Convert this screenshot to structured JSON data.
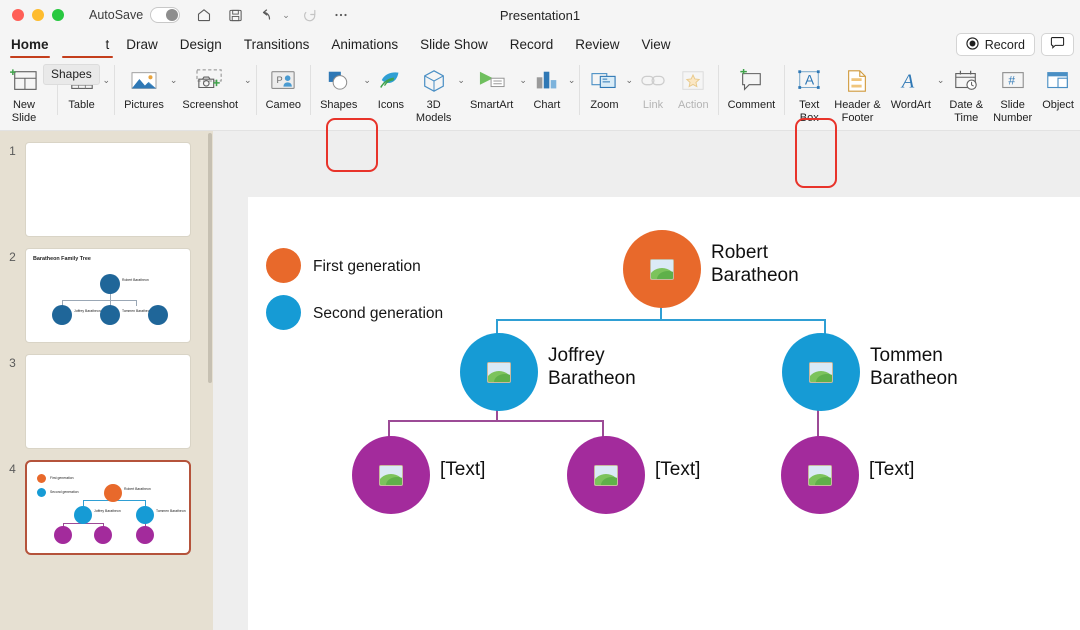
{
  "window": {
    "title": "Presentation1",
    "autosave_label": "AutoSave",
    "traffic_lights": [
      "close",
      "minimize",
      "maximize"
    ],
    "toolbar_icons": [
      "home-icon",
      "save-icon",
      "undo-icon",
      "redo-icon",
      "more-icon"
    ]
  },
  "tabs": [
    {
      "label": "Home",
      "state": "active"
    },
    {
      "label": "t",
      "state": "partial",
      "full": "Insert"
    },
    {
      "label": "Draw",
      "state": "normal"
    },
    {
      "label": "Design",
      "state": "normal"
    },
    {
      "label": "Transitions",
      "state": "normal"
    },
    {
      "label": "Animations",
      "state": "normal"
    },
    {
      "label": "Slide Show",
      "state": "normal"
    },
    {
      "label": "Record",
      "state": "normal"
    },
    {
      "label": "Review",
      "state": "normal"
    },
    {
      "label": "View",
      "state": "normal"
    }
  ],
  "tooltip": {
    "text": "Shapes"
  },
  "tabbar_right": {
    "record_label": "Record",
    "record_icon": "record-circle-icon",
    "comment_icon": "comment-bubble-icon"
  },
  "ribbon": {
    "items": [
      {
        "label": "New\nSlide",
        "icon": "new-slide-icon",
        "caret": true,
        "disabled": false
      },
      {
        "label": "Table",
        "icon": "table-icon",
        "caret": true,
        "disabled": false
      },
      {
        "label": "Pictures",
        "icon": "pictures-icon",
        "caret": true,
        "disabled": false
      },
      {
        "label": "Screenshot",
        "icon": "screenshot-icon",
        "caret": true,
        "disabled": false
      },
      {
        "label": "Cameo",
        "icon": "cameo-icon",
        "caret": false,
        "disabled": false
      },
      {
        "label": "Shapes",
        "icon": "shapes-icon",
        "caret": true,
        "disabled": false,
        "highlighted": true
      },
      {
        "label": "Icons",
        "icon": "icons-icon",
        "caret": false,
        "disabled": false
      },
      {
        "label": "3D\nModels",
        "icon": "3d-models-icon",
        "caret": true,
        "disabled": false
      },
      {
        "label": "SmartArt",
        "icon": "smartart-icon",
        "caret": true,
        "disabled": false
      },
      {
        "label": "Chart",
        "icon": "chart-icon",
        "caret": true,
        "disabled": false
      },
      {
        "label": "Zoom",
        "icon": "zoom-icon",
        "caret": true,
        "disabled": false
      },
      {
        "label": "Link",
        "icon": "link-icon",
        "caret": false,
        "disabled": true
      },
      {
        "label": "Action",
        "icon": "action-star-icon",
        "caret": false,
        "disabled": true
      },
      {
        "label": "Comment",
        "icon": "comment-icon",
        "caret": false,
        "disabled": false
      },
      {
        "label": "Text\nBox",
        "icon": "text-box-icon",
        "caret": false,
        "disabled": false,
        "highlighted": true
      },
      {
        "label": "Header &\nFooter",
        "icon": "header-footer-icon",
        "caret": false,
        "disabled": false
      },
      {
        "label": "WordArt",
        "icon": "wordart-icon",
        "caret": true,
        "disabled": false
      },
      {
        "label": "Date &\nTime",
        "icon": "date-time-icon",
        "caret": false,
        "disabled": false
      },
      {
        "label": "Slide\nNumber",
        "icon": "slide-number-icon",
        "caret": false,
        "disabled": false
      },
      {
        "label": "Object",
        "icon": "object-icon",
        "caret": false,
        "disabled": false
      }
    ]
  },
  "slide_panel": {
    "thumbnails": [
      {
        "number": "1",
        "selected": false,
        "type": "blank"
      },
      {
        "number": "2",
        "selected": false,
        "type": "family-tree-dark",
        "title": "Baratheon Family Tree"
      },
      {
        "number": "3",
        "selected": false,
        "type": "blank"
      },
      {
        "number": "4",
        "selected": true,
        "type": "family-tree-color"
      }
    ],
    "thumb2_labels": [
      "Robert\nBaratheon",
      "Joffrey\nBaratheon",
      "Tommen\nBaratheon"
    ],
    "thumb4_labels": [
      "First generation",
      "Second generation",
      "Robert\nBaratheon",
      "Joffrey\nBaratheon",
      "Tommen\nBaratheon"
    ]
  },
  "slide": {
    "legend": [
      {
        "label": "First generation",
        "color": "#E8692B"
      },
      {
        "label": "Second generation",
        "color": "#169BD5"
      }
    ],
    "nodes": [
      {
        "id": "robert",
        "label": "Robert\nBaratheon",
        "color": "#E8692B",
        "generation": 1,
        "icon": "picture-placeholder-icon"
      },
      {
        "id": "joffrey",
        "label": "Joffrey\nBaratheon",
        "color": "#169BD5",
        "generation": 2,
        "icon": "picture-placeholder-icon"
      },
      {
        "id": "tommen",
        "label": "Tommen\nBaratheon",
        "color": "#169BD5",
        "generation": 2,
        "icon": "picture-placeholder-icon"
      },
      {
        "id": "child1",
        "label": "[Text]",
        "color": "#A32B9C",
        "generation": 3,
        "icon": "picture-placeholder-icon"
      },
      {
        "id": "child2",
        "label": "[Text]",
        "color": "#A32B9C",
        "generation": 3,
        "icon": "picture-placeholder-icon"
      },
      {
        "id": "child3",
        "label": "[Text]",
        "color": "#A32B9C",
        "generation": 3,
        "icon": "picture-placeholder-icon"
      }
    ],
    "connector_colors": {
      "gen1_to_gen2": "#2F9FD4",
      "gen2_to_gen3": "#9C4B96"
    }
  }
}
